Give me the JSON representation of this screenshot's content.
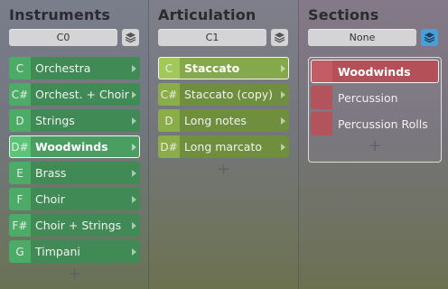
{
  "instruments": {
    "title": "Instruments",
    "key_value": "C0",
    "items": [
      {
        "key": "C",
        "label": "Orchestra"
      },
      {
        "key": "C#",
        "label": "Orchest. + Choir"
      },
      {
        "key": "D",
        "label": "Strings"
      },
      {
        "key": "D#",
        "label": "Woodwinds"
      },
      {
        "key": "E",
        "label": "Brass"
      },
      {
        "key": "F",
        "label": "Choir"
      },
      {
        "key": "F#",
        "label": "Choir + Strings"
      },
      {
        "key": "G",
        "label": "Timpani"
      }
    ],
    "selected": "Woodwinds",
    "add": "+"
  },
  "articulation": {
    "title": "Articulation",
    "key_value": "C1",
    "items": [
      {
        "key": "C",
        "label": "Staccato"
      },
      {
        "key": "C#",
        "label": "Staccato (copy)"
      },
      {
        "key": "D",
        "label": "Long notes"
      },
      {
        "key": "D#",
        "label": "Long marcato"
      }
    ],
    "selected": "Staccato",
    "add": "+"
  },
  "sections": {
    "title": "Sections",
    "key_value": "None",
    "items": [
      {
        "label": "Woodwinds"
      },
      {
        "label": "Percussion"
      },
      {
        "label": "Percussion Rolls"
      }
    ],
    "selected": "Woodwinds",
    "add": "+"
  },
  "colors": {
    "instrument_green": "#4cab66",
    "articulation_olive": "#8bad47",
    "section_red": "#b3545d",
    "layer_active_blue": "#4a9fd8"
  },
  "icons": {
    "layer": "layers-icon",
    "chevron": "chevron-right-icon"
  }
}
